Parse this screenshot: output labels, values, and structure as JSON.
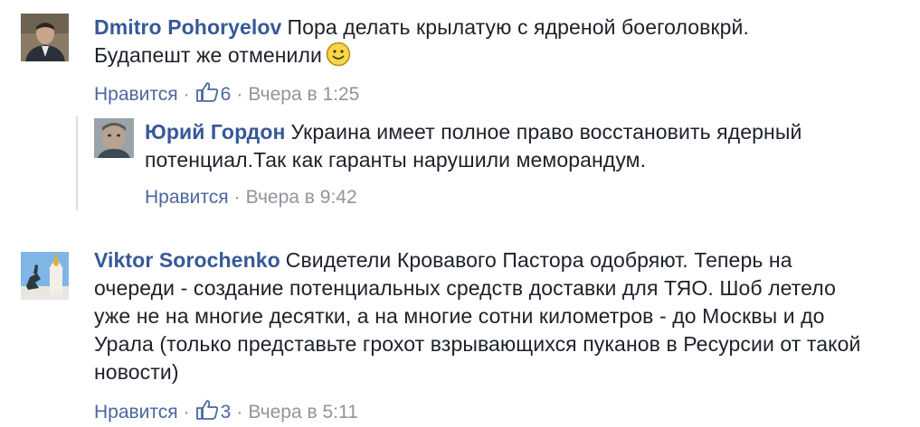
{
  "comments": [
    {
      "author": "Dmitro Pohoryelov",
      "text": "Пора делать крылатую с ядреной боеголовкрй. Будапешт же отменили",
      "like_label": "Нравится",
      "likes": "6",
      "time": "Вчера в 1:25"
    },
    {
      "author": "Юрий Гордон",
      "text": "Украина имеет полное право восстановить ядерный потенциал.Так как гаранты нарушили меморандум.",
      "like_label": "Нравится",
      "time": "Вчера в 9:42"
    },
    {
      "author": "Viktor Sorochenko",
      "text": "Свидетели Кровавого Пастора одобряют. Теперь на очереди - создание потенциальных средств доставки для ТЯО. Шоб летело уже не на многие десятки, а на многие сотни километров - до Москвы и до Урала (только представьте грохот взрывающихся пуканов в Ресурсии от такой новости)",
      "like_label": "Нравится",
      "likes": "3",
      "time": "Вчера в 5:11"
    }
  ],
  "separator": "·",
  "icons": {
    "like": "thumbs-up-icon",
    "emoji": "smiley-icon"
  },
  "colors": {
    "author": "#365899",
    "link": "#4b67a1",
    "meta": "#90949c"
  }
}
